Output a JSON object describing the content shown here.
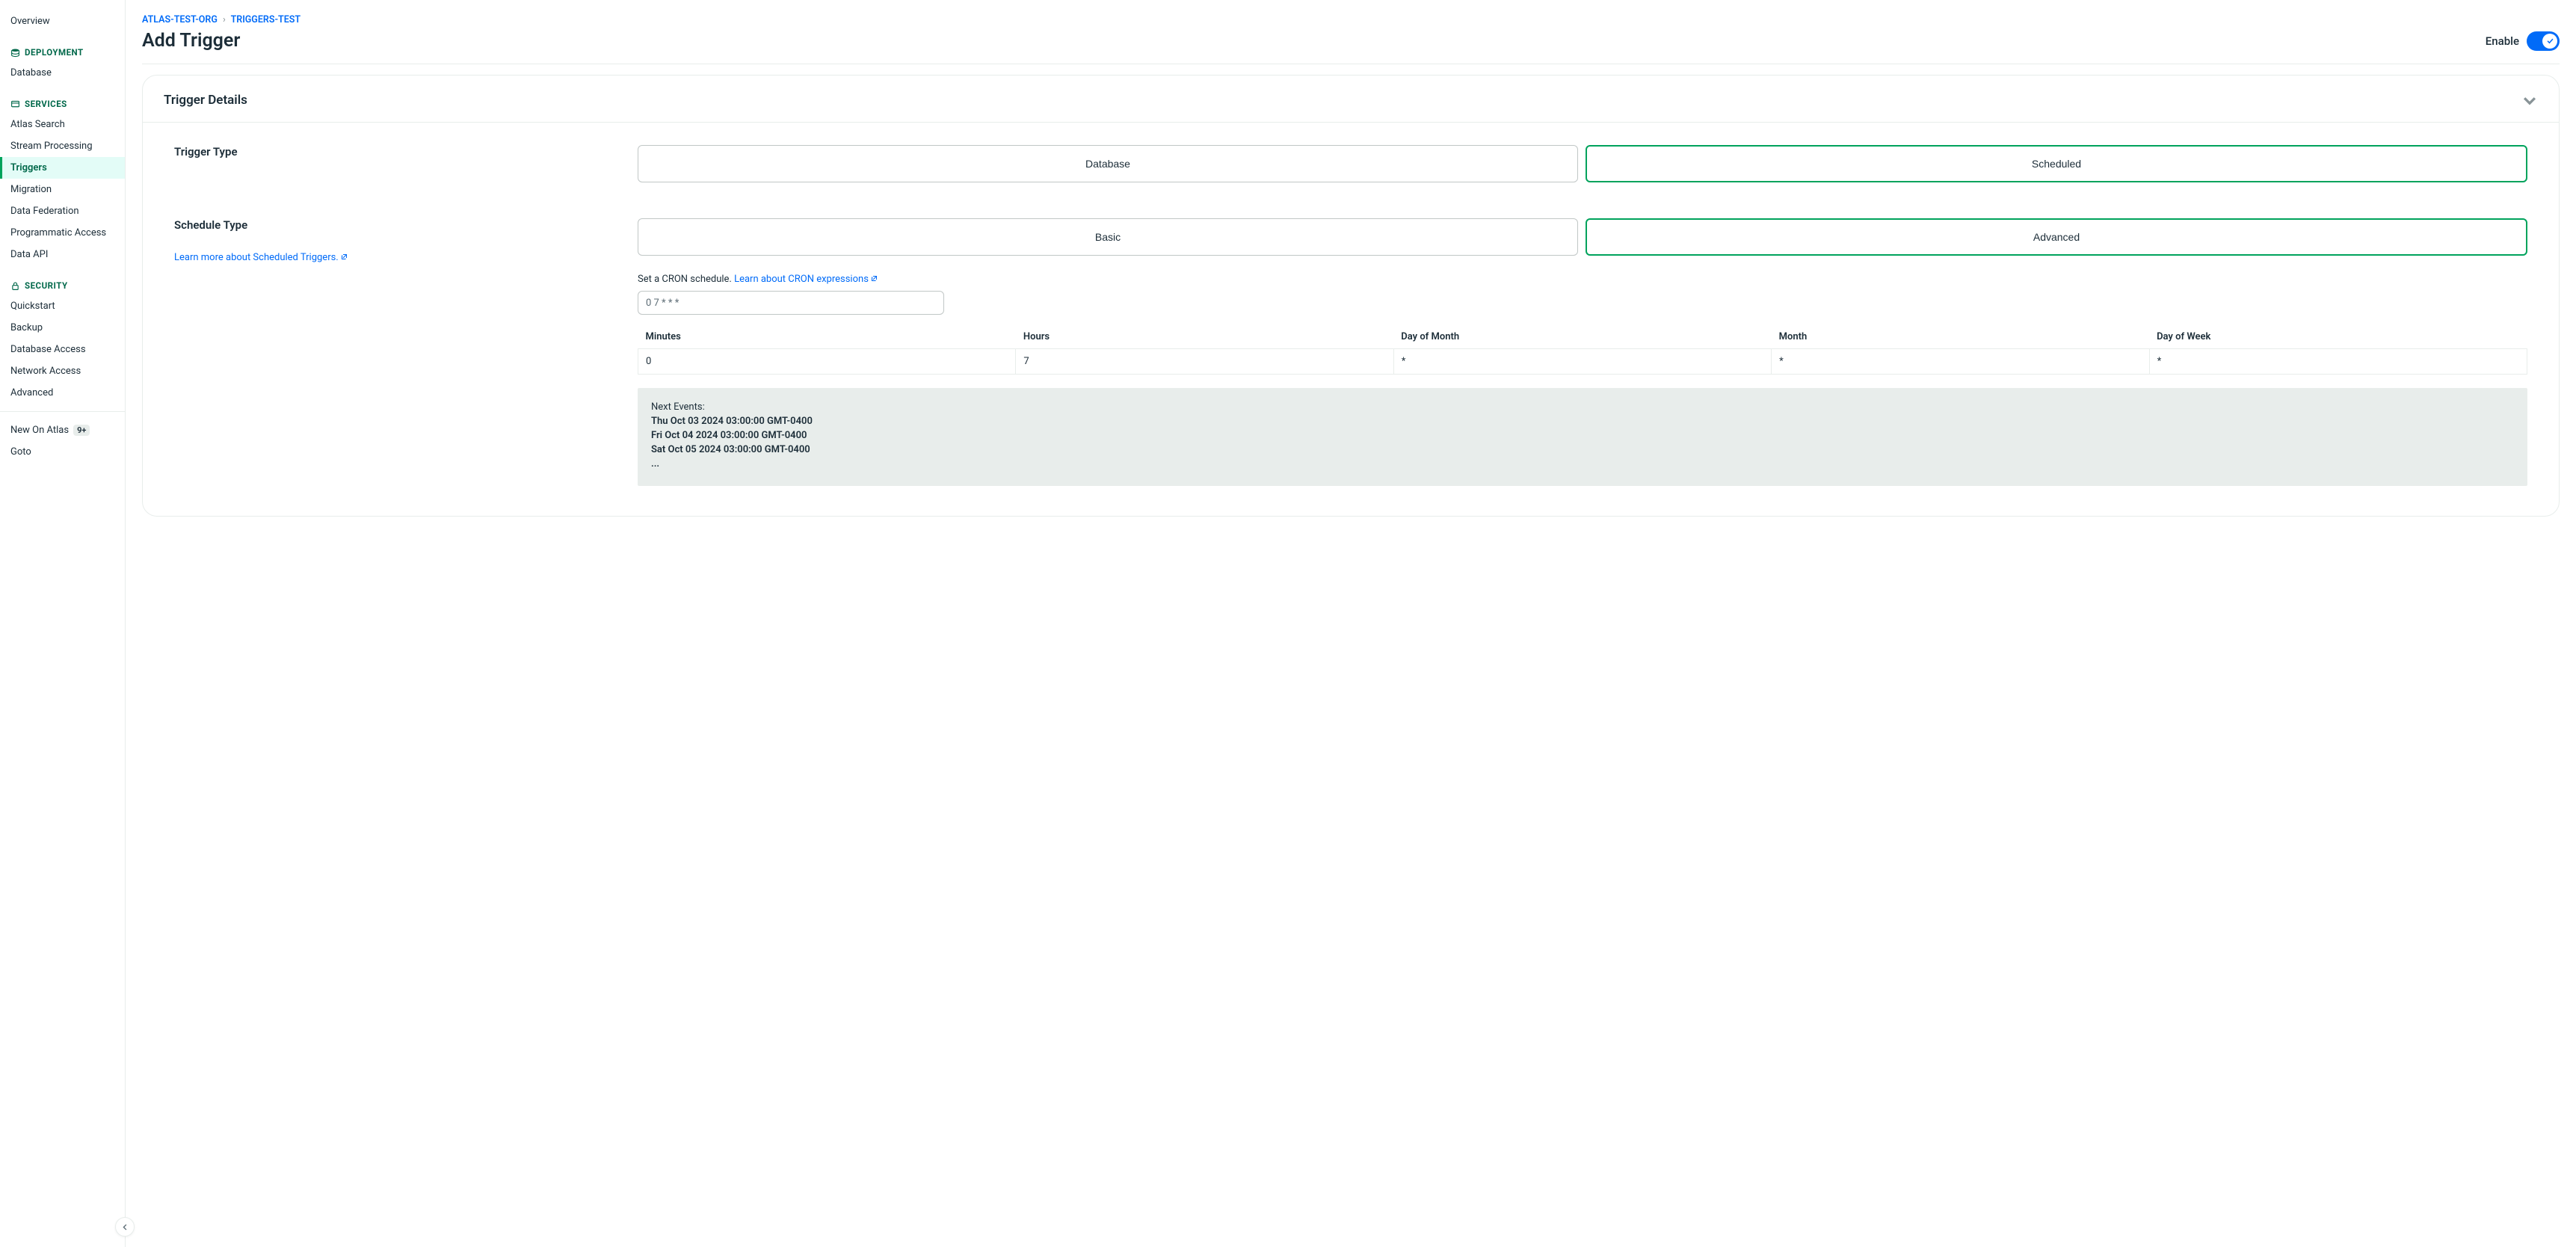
{
  "sidebar": {
    "overview": "Overview",
    "sections": {
      "deployment": {
        "title": "DEPLOYMENT",
        "items": [
          "Database"
        ]
      },
      "services": {
        "title": "SERVICES",
        "items": [
          "Atlas Search",
          "Stream Processing",
          "Triggers",
          "Migration",
          "Data Federation",
          "Programmatic Access",
          "Data API"
        ],
        "active": "Triggers"
      },
      "security": {
        "title": "SECURITY",
        "items": [
          "Quickstart",
          "Backup",
          "Database Access",
          "Network Access",
          "Advanced"
        ]
      }
    },
    "footer": {
      "newOnAtlas": "New On Atlas",
      "badge": "9+",
      "goto": "Goto"
    }
  },
  "breadcrumb": {
    "org": "ATLAS-TEST-ORG",
    "project": "TRIGGERS-TEST"
  },
  "page": {
    "title": "Add Trigger",
    "enableLabel": "Enable"
  },
  "card": {
    "title": "Trigger Details",
    "triggerType": {
      "label": "Trigger Type",
      "options": [
        "Database",
        "Scheduled"
      ],
      "selected": "Scheduled"
    },
    "scheduleType": {
      "label": "Schedule Type",
      "options": [
        "Basic",
        "Advanced"
      ],
      "selected": "Advanced",
      "learnText": "Learn more about Scheduled Triggers."
    },
    "cron": {
      "helpPrefix": "Set a CRON schedule. ",
      "helpLink": "Learn about CRON expressions",
      "value": "0 7 * * *",
      "headers": [
        "Minutes",
        "Hours",
        "Day of Month",
        "Month",
        "Day of Week"
      ],
      "cells": [
        "0",
        "7",
        "*",
        "*",
        "*"
      ]
    },
    "events": {
      "title": "Next Events:",
      "items": [
        "Thu Oct 03 2024 03:00:00 GMT-0400",
        "Fri Oct 04 2024 03:00:00 GMT-0400",
        "Sat Oct 05 2024 03:00:00 GMT-0400"
      ],
      "more": "..."
    }
  }
}
